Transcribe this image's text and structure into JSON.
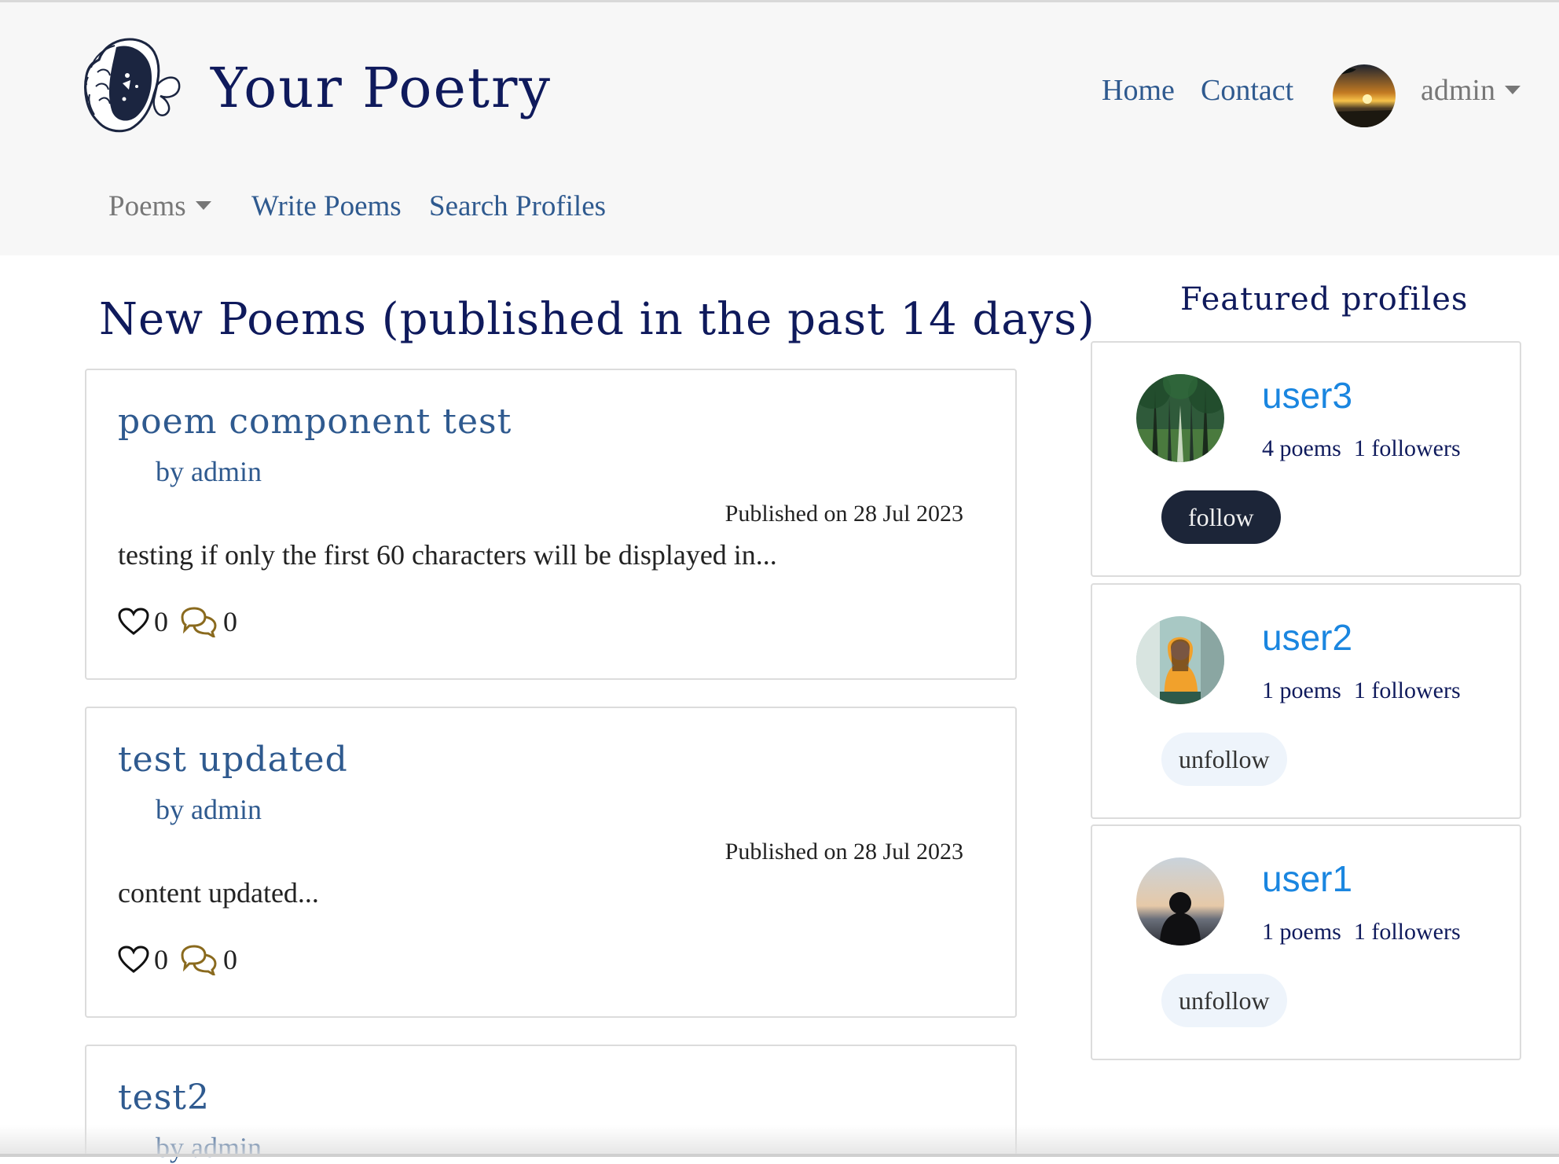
{
  "brand": {
    "title": "Your Poetry"
  },
  "top_nav": {
    "home": "Home",
    "contact": "Contact",
    "user": "admin"
  },
  "sub_nav": {
    "poems": "Poems",
    "write": "Write Poems",
    "search": "Search Profiles"
  },
  "main": {
    "title": "New Poems (published in the past 14 days)",
    "poems": [
      {
        "title": "poem component test",
        "author": "by admin",
        "date": "Published on 28 Jul 2023",
        "excerpt": "testing if only the first 60 characters will be displayed in...",
        "likes": "0",
        "comments": "0"
      },
      {
        "title": "test updated",
        "author": "by admin",
        "date": "Published on 28 Jul 2023",
        "excerpt": "content updated...",
        "likes": "0",
        "comments": "0"
      },
      {
        "title": "test2",
        "author": "by admin"
      }
    ]
  },
  "featured": {
    "title": "Featured profiles",
    "profiles": [
      {
        "name": "user3",
        "poems": "4 poems",
        "followers": "1 followers",
        "button": "follow"
      },
      {
        "name": "user2",
        "poems": "1 poems",
        "followers": "1 followers",
        "button": "unfollow"
      },
      {
        "name": "user1",
        "poems": "1 poems",
        "followers": "1 followers",
        "button": "unfollow"
      }
    ]
  },
  "colors": {
    "brand": "#0f1a5c",
    "link": "#2f5a8f",
    "profile_link": "#1a86e0",
    "follow_dark": "#1c2538",
    "comment_icon": "#8a6a1e"
  },
  "icons": {
    "like": "heart-icon",
    "comment": "chat-bubbles-icon",
    "dropdown": "caret-down-icon"
  }
}
